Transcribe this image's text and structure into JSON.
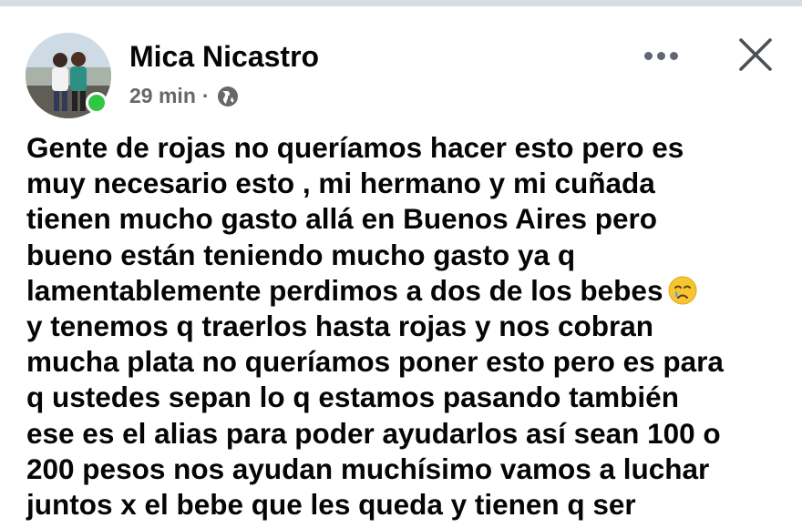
{
  "post": {
    "author": "Mica Nicastro",
    "time": "29 min",
    "separator": "·",
    "privacy_icon": "globe-icon",
    "menu_icon": "more-dots-icon",
    "close_icon": "close-icon",
    "author_online": true,
    "online_color": "#31c744",
    "text_lines": [
      "Gente de rojas no queríamos hacer esto pero es",
      "muy necesario esto , mi hermano y mi cuñada",
      "tienen mucho gasto allá en Buenos Aires pero",
      "bueno están teniendo mucho gasto ya q",
      "lamentablemente perdimos a dos de los bebes",
      "y tenemos q traerlos hasta rojas y nos cobran",
      "mucha plata no queríamos poner esto pero es para",
      "q ustedes sepan lo q estamos pasando también",
      "ese es el alias para poder ayudarlos así sean 100 o",
      "200 pesos nos ayudan muchísimo vamos a luchar",
      "juntos x el bebe que les queda y tienen q ser"
    ],
    "inline_emoji": "crying-face-emoji"
  }
}
